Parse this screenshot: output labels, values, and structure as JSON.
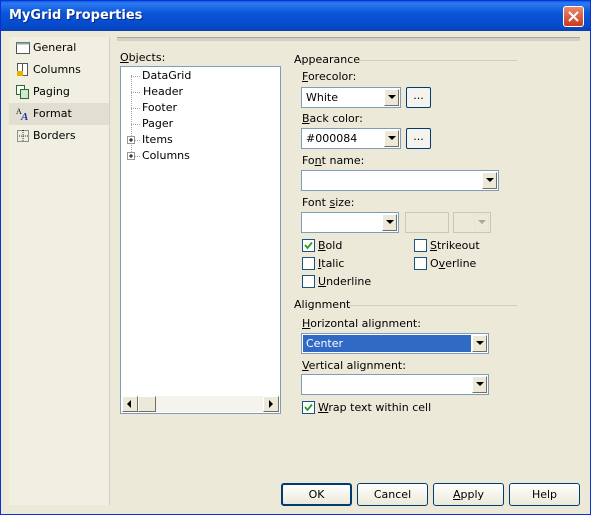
{
  "window": {
    "title": "MyGrid Properties"
  },
  "sidebar": {
    "items": [
      {
        "label": "General",
        "icon": "general-icon"
      },
      {
        "label": "Columns",
        "icon": "columns-icon"
      },
      {
        "label": "Paging",
        "icon": "paging-icon"
      },
      {
        "label": "Format",
        "icon": "format-icon"
      },
      {
        "label": "Borders",
        "icon": "borders-icon"
      }
    ],
    "selected": "Format"
  },
  "objects": {
    "label": "Objects:",
    "items": [
      "DataGrid",
      "Header",
      "Footer",
      "Pager",
      "Items",
      "Columns"
    ],
    "selected": "Header"
  },
  "appearance": {
    "group_label": "Appearance",
    "forecolor_label": "Forecolor:",
    "forecolor_value": "White",
    "backcolor_label": "Back color:",
    "backcolor_value": "#000084",
    "ellipsis": "...",
    "fontname_label": "Font name:",
    "fontname_value": "",
    "fontsize_label": "Font size:",
    "fontsize_value": "",
    "bold_label": "Bold",
    "bold_checked": true,
    "italic_label": "Italic",
    "italic_checked": false,
    "underline_label": "Underline",
    "underline_checked": false,
    "strikeout_label": "Strikeout",
    "strikeout_checked": false,
    "overline_label": "Overline",
    "overline_checked": false
  },
  "alignment": {
    "group_label": "Alignment",
    "horizontal_label": "Horizontal alignment:",
    "horizontal_value": "Center",
    "vertical_label": "Vertical alignment:",
    "vertical_value": "",
    "wrap_label": "Wrap text within cell",
    "wrap_checked": true
  },
  "buttons": {
    "ok": "OK",
    "cancel": "Cancel",
    "apply": "Apply",
    "help": "Help"
  },
  "colors": {
    "titlebar": "#0548c8",
    "selection": "#316ac5",
    "dialog_bg": "#ece9d8"
  }
}
